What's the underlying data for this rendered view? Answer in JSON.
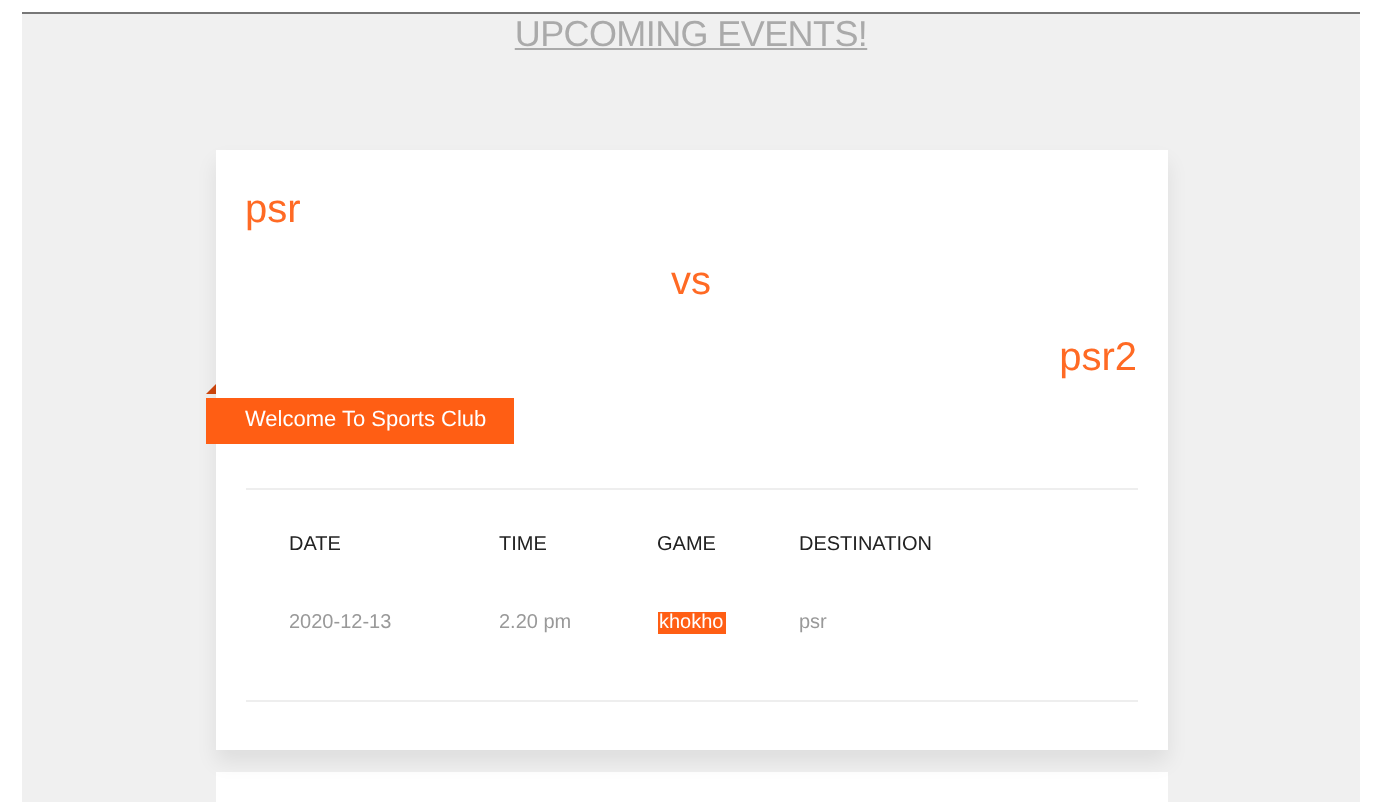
{
  "heading": "UPCOMING EVENTS!",
  "events": [
    {
      "team_1": "psr",
      "versus": "vs",
      "team_2": "psr2",
      "ribbon": "Welcome To Sports Club",
      "columns": [
        "DATE",
        "TIME",
        "GAME",
        "DESTINATION"
      ],
      "values": [
        {
          "text": "2020-12-13",
          "highlighted": false
        },
        {
          "text": "2.20 pm",
          "highlighted": false
        },
        {
          "text": "khokho",
          "highlighted": true
        },
        {
          "text": "psr",
          "highlighted": false
        }
      ]
    }
  ],
  "more_cards": true
}
